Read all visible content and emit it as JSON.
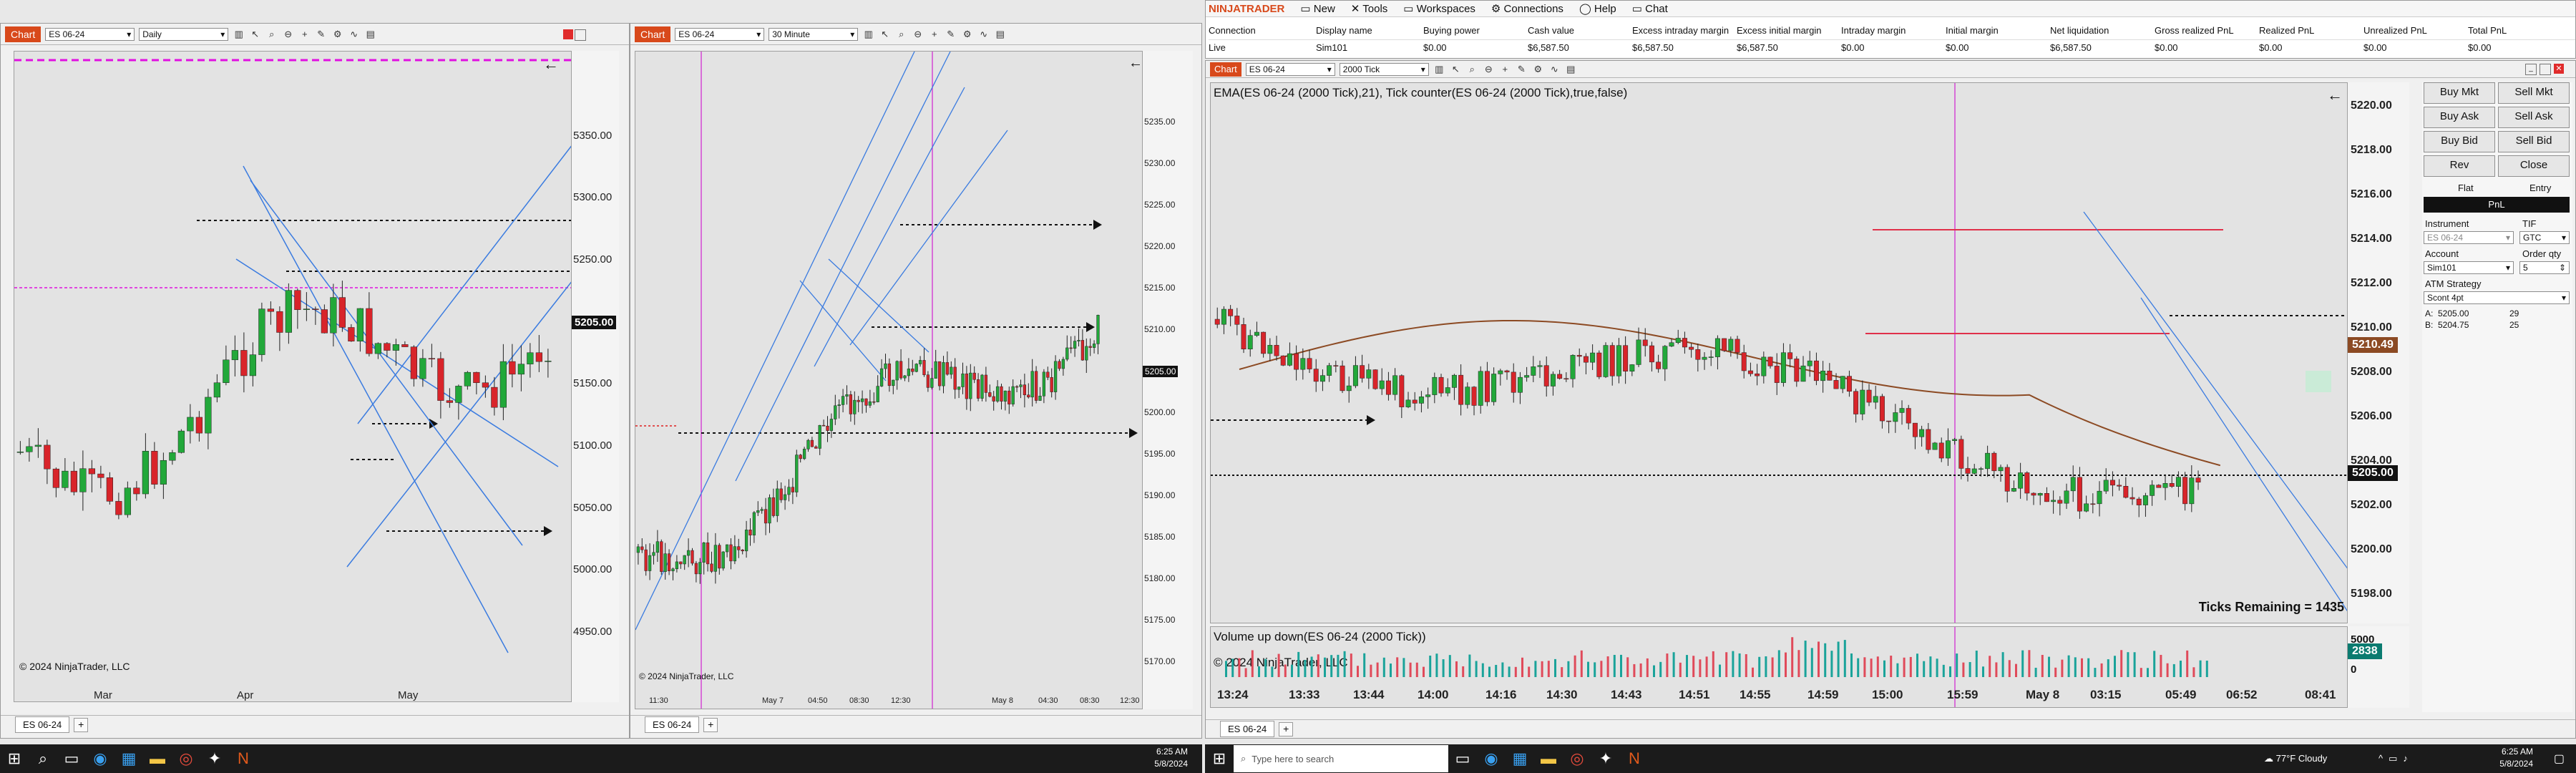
{
  "window_left": {
    "chart_tag": "Chart",
    "instrument": "ES 06-24",
    "period": "Daily",
    "prices": [
      "5350.00",
      "5300.00",
      "5250.00",
      "5205.00",
      "5150.00",
      "5100.00",
      "5050.00",
      "5000.00",
      "4950.00"
    ],
    "current_price": "5205.00",
    "months": [
      "Mar",
      "Apr",
      "May"
    ],
    "copyright": "© 2024 NinjaTrader, LLC",
    "tab": "ES 06-24"
  },
  "window_mid": {
    "chart_tag": "Chart",
    "instrument": "ES 06-24",
    "period": "30 Minute",
    "prices": [
      "5235.00",
      "5230.00",
      "5225.00",
      "5220.00",
      "5215.00",
      "5210.00",
      "5205.00",
      "5200.00",
      "5195.00",
      "5190.00",
      "5185.00",
      "5180.00",
      "5175.00",
      "5170.00"
    ],
    "current_price": "5205.00",
    "times": [
      "11:30",
      "May 7",
      "04:50",
      "08:30",
      "12:30",
      "May 8",
      "04:30",
      "08:30",
      "12:30"
    ],
    "copyright": "© 2024 NinjaTrader, LLC",
    "tab": "ES 06-24"
  },
  "control_center": {
    "brand": "NINJATRADER",
    "menu": [
      "New",
      "Tools",
      "Workspaces",
      "Connections",
      "Help",
      "Chat"
    ],
    "headers": [
      "Connection",
      "Display name",
      "Buying power",
      "Cash value",
      "Excess intraday margin",
      "Excess initial margin",
      "Intraday margin",
      "Initial margin",
      "Net liquidation",
      "Gross realized PnL",
      "Realized PnL",
      "Unrealized PnL",
      "Total PnL"
    ],
    "row": [
      "Live",
      "Sim101",
      "$0.00",
      "$6,587.50",
      "$6,587.50",
      "$6,587.50",
      "$0.00",
      "$0.00",
      "$6,587.50",
      "$0.00",
      "$0.00",
      "$0.00",
      "$0.00"
    ]
  },
  "window_right": {
    "chart_tag": "Chart",
    "instrument": "ES 06-24",
    "period": "2000 Tick",
    "indicator_title": "EMA(ES 06-24 (2000 Tick),21), Tick counter(ES 06-24 (2000 Tick),true,false)",
    "prices": [
      "5220.00",
      "5218.00",
      "5216.00",
      "5214.00",
      "5212.00",
      "5210.00",
      "5208.00",
      "5206.00",
      "5204.00",
      "5202.00",
      "5200.00",
      "5198.00"
    ],
    "ema_value": "5210.49",
    "current_price": "5205.00",
    "ticks_remaining": "Ticks Remaining = 1435",
    "volume_title": "Volume up down(ES 06-24 (2000 Tick))",
    "volume_value": "2838",
    "volume_axis": [
      "5000",
      "0"
    ],
    "copyright": "© 2024 NinjaTrader, LLC",
    "times": [
      "13:24",
      "13:33",
      "13:44",
      "14:00",
      "14:16",
      "14:30",
      "14:43",
      "14:51",
      "14:55",
      "14:59",
      "15:00",
      "15:59",
      "May 8",
      "03:15",
      "05:49",
      "06:52",
      "08:41"
    ],
    "tab": "ES 06-24"
  },
  "chart_trader": {
    "buttons": [
      "Buy Mkt",
      "Sell Mkt",
      "Buy Ask",
      "Sell Ask",
      "Buy Bid",
      "Sell Bid",
      "Rev",
      "Close"
    ],
    "flat": "Flat",
    "entry": "Entry",
    "pnl": "PnL",
    "instrument_label": "Instrument",
    "instrument_value": "ES 06-24",
    "tif_label": "TIF",
    "tif_value": "GTC",
    "account_label": "Account",
    "account_value": "Sim101",
    "qty_label": "Order qty",
    "qty_value": "5",
    "atm_label": "ATM Strategy",
    "atm_value": "Scont 4pt",
    "ask_label": "A:",
    "ask_price": "5205.00",
    "ask_size": "29",
    "bid_label": "B:",
    "bid_price": "5204.75",
    "bid_size": "25"
  },
  "taskbar_left": {
    "time": "6:25 AM",
    "date": "5/8/2024"
  },
  "taskbar_right": {
    "search_placeholder": "Type here to search",
    "weather": "77°F  Cloudy",
    "time": "6:25 AM",
    "date": "5/8/2024"
  }
}
